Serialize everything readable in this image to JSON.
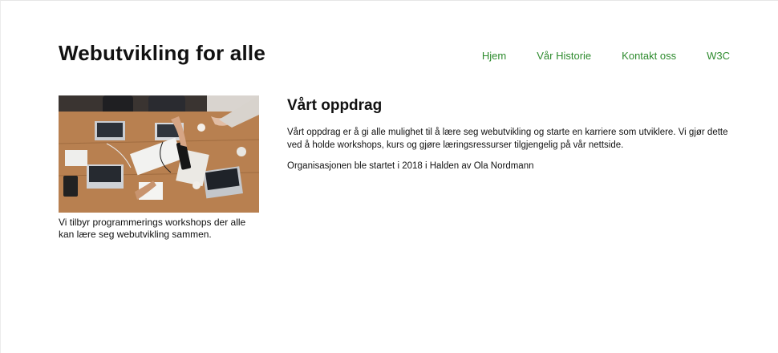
{
  "header": {
    "title": "Webutvikling for alle",
    "nav": [
      {
        "label": "Hjem"
      },
      {
        "label": "Vår Historie"
      },
      {
        "label": "Kontakt oss"
      },
      {
        "label": "W3C"
      }
    ]
  },
  "figure": {
    "caption": "Vi tilbyr programmerings workshops der alle kan lære seg webutvikling sammen."
  },
  "mission": {
    "heading": "Vårt oppdrag",
    "paragraph1": "Vårt oppdrag er å gi alle mulighet til å lære seg webutvikling og starte en karriere som utviklere. Vi gjør dette ved å holde workshops, kurs og gjøre læringsressurser tilgjengelig på vår nettside.",
    "paragraph2": "Organisasjonen ble startet i 2018 i Halden av Ola Nordmann"
  },
  "colors": {
    "nav_link": "#2e8b2e",
    "text": "#111111",
    "background": "#ffffff"
  }
}
